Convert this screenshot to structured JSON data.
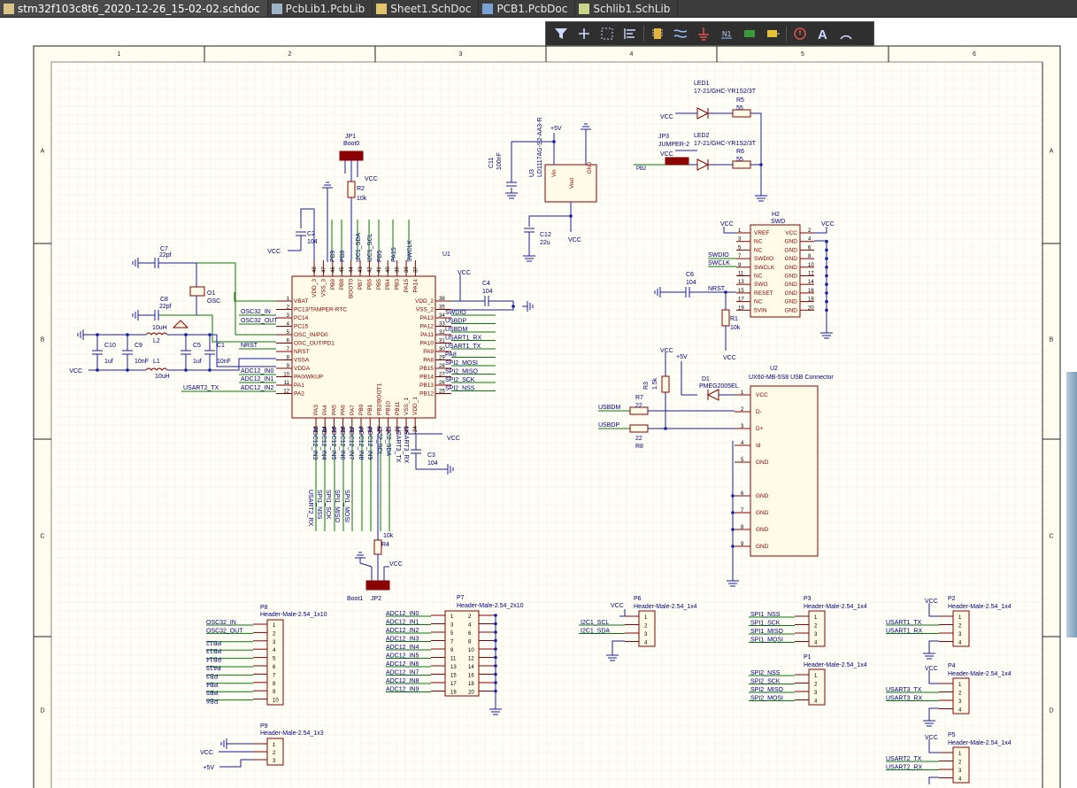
{
  "tabs": [
    {
      "label": "stm32f103c8t6_2020-12-26_15-02-02.schdoc",
      "active": true,
      "icon": "schematic-doc-icon"
    },
    {
      "label": "PcbLib1.PcbLib",
      "active": false,
      "icon": "pcblib-icon"
    },
    {
      "label": "Sheet1.SchDoc",
      "active": false,
      "icon": "schdoc-icon"
    },
    {
      "label": "PCB1.PcbDoc",
      "active": false,
      "icon": "pcbdoc-icon"
    },
    {
      "label": "Schlib1.SchLib",
      "active": false,
      "icon": "schlib-icon"
    }
  ],
  "toolbar": {
    "items": [
      "filter-icon",
      "add-icon",
      "select-rect-icon",
      "align-icon",
      "component-icon",
      "wire-icon",
      "ground-icon",
      "net-label-icon",
      "port-icon",
      "harness-icon",
      "no-erc-icon",
      "text-icon",
      "arc-icon"
    ]
  },
  "border": {
    "cols": [
      "1",
      "2",
      "3",
      "4",
      "5",
      "6"
    ],
    "rows": [
      "A",
      "B",
      "C",
      "D"
    ]
  },
  "schematic": {
    "u1": {
      "ref": "U1",
      "left_pins": [
        [
          "1",
          "VBAT"
        ],
        [
          "2",
          "PC13/TAMPER-RTC"
        ],
        [
          "3",
          "PC14"
        ],
        [
          "4",
          "PC15"
        ],
        [
          "5",
          "OSC_IN/PD0"
        ],
        [
          "6",
          "OSC_OUT/PD1"
        ],
        [
          "7",
          "NRST"
        ],
        [
          "8",
          "VSSA"
        ],
        [
          "9",
          "VDDA"
        ],
        [
          "10",
          "PA0/WKUP"
        ],
        [
          "11",
          "PA1"
        ],
        [
          "12",
          "PA2"
        ]
      ],
      "right_pins": [
        [
          "36",
          "VDD_2"
        ],
        [
          "35",
          "VSS_2"
        ],
        [
          "34",
          "PA13"
        ],
        [
          "33",
          "PA12"
        ],
        [
          "32",
          "PA11"
        ],
        [
          "31",
          "PA10"
        ],
        [
          "30",
          "PA9"
        ],
        [
          "29",
          "PA8"
        ],
        [
          "28",
          "PB15"
        ],
        [
          "27",
          "PB14"
        ],
        [
          "26",
          "PB13"
        ],
        [
          "25",
          "PB12"
        ]
      ],
      "top_pins": [
        "48",
        "47",
        "46",
        "45",
        "44",
        "43",
        "42",
        "41",
        "40",
        "39",
        "38",
        "37"
      ],
      "top_names": [
        "VDD_3",
        "VSS_3",
        "PB9",
        "PB8",
        "BOOT0",
        "PB7",
        "PB6",
        "PB5",
        "PB4",
        "PB3",
        "PA15",
        "PA14"
      ],
      "bottom_pins": [
        "13",
        "14",
        "15",
        "16",
        "17",
        "18",
        "19",
        "20",
        "21",
        "22",
        "23",
        "24"
      ],
      "bottom_names": [
        "PA3",
        "PA4",
        "PA5",
        "PA6",
        "PA7",
        "PB0",
        "PB1",
        "PB2/BOOT1",
        "PB10",
        "PB11",
        "VSS_1",
        "VDD_1"
      ]
    },
    "u1_left_nets": [
      "OSC32_IN",
      "OSC32_OUT",
      "NRST",
      "ADC12_IN0",
      "ADC12_IN1",
      "ADC12_IN2",
      "USART2_TX"
    ],
    "u1_right_nets": [
      "SWDIO",
      "USBDP",
      "USBDM",
      "USART1_RX",
      "USART1_TX",
      "PA8",
      "SPI2_MOSI",
      "SPI2_MISO",
      "SPI2_SCK",
      "SPI2_NSS"
    ],
    "u1_top_nets": [
      "PB9",
      "PB8",
      "I2C1_SDA",
      "I2C1_SCL",
      "PB5",
      "PA15",
      "SWCLK"
    ],
    "u1_bottom_nets": [
      "ADC12_IN3",
      "ADC12_IN4",
      "ADC12_IN5",
      "ADC12_IN6",
      "ADC12_IN7",
      "ADC12_IN8",
      "ADC12_IN9",
      "I2C2_SCL",
      "I2C2_SDA",
      "USART3_TX",
      "USART3_RX"
    ],
    "u1_bottom_nets2": [
      "USART2_RX",
      "SPI1_NSS",
      "SPI1_SCK",
      "SPI1_MISO",
      "SPI1_MOSI"
    ],
    "labels": {
      "jp1": "JP1",
      "jp1_val": "Boot0",
      "r2": "R2",
      "r2_val": "10k",
      "c2": "C2",
      "c2_val": "104",
      "c7": "C7",
      "c7_val": "22pf",
      "c8": "C8",
      "c8_val": "22pf",
      "o1": "O1",
      "o1_val": "OSC",
      "l2": "L2",
      "l2_val": "10uH",
      "l1": "L1",
      "l1_val": "10uH",
      "c10": "C10",
      "c10_val": "1uf",
      "c9": "C9",
      "c9_val": "10nF",
      "c5": "C5",
      "c5_val": "1uf",
      "c1": "C1",
      "c1_val": "10nF",
      "c4": "C4",
      "c4_val": "104",
      "c3": "C3",
      "c3_val": "104",
      "r4": "R4",
      "r4_val": "10k",
      "jp2": "JP2",
      "jp2_val": "Boot1",
      "u3": "U3",
      "u3_val": "LD1117AG-S2-AA3-R",
      "c11": "C11",
      "c11_val": "100nF",
      "c12": "C12",
      "c12_val": "22u",
      "vin": "Vin",
      "vout": "Vout",
      "gnd": "GND",
      "p5v": "+5V",
      "vcc": "VCC",
      "led1": "LED1",
      "led1_val": "17-21/GHC-YR1S2/3T",
      "led2": "LED2",
      "led2_val": "17-21/GHC-YR1S2/3T",
      "r5": "R5",
      "r5_val": "55",
      "r6": "R6",
      "r6_val": "55",
      "jp3": "JP3",
      "jp3_val": "JUMPER-2",
      "pb2": "PB2",
      "h2": "H2",
      "h2_val": "SWD",
      "c6": "C6",
      "c6_val": "104",
      "r1": "R1",
      "r1_val": "10k",
      "swdio": "SWDIO",
      "swclk": "SWCLK",
      "nrst": "NRST",
      "d1": "D1",
      "d1_val": "PMEG2005EL",
      "r3": "R3",
      "r3_val": "1.5k",
      "r7": "R7",
      "r7_val": "22",
      "r8": "R8",
      "r8_val": "22",
      "u2": "U2",
      "u2_val": "UX60-MB-5S8 USB Connector",
      "usbdm": "USBDM",
      "usbdp": "USBDP"
    },
    "h2_left": [
      [
        "1",
        "VREF"
      ],
      [
        "3",
        "NC"
      ],
      [
        "5",
        "NC"
      ],
      [
        "7",
        "SWDIO"
      ],
      [
        "9",
        "SWCLK"
      ],
      [
        "11",
        "NC"
      ],
      [
        "13",
        "SWO"
      ],
      [
        "15",
        "RESET"
      ],
      [
        "17",
        "NC"
      ],
      [
        "19",
        "5VIN"
      ]
    ],
    "h2_right": [
      [
        "2",
        "VCC"
      ],
      [
        "4",
        "GND"
      ],
      [
        "6",
        "GND"
      ],
      [
        "8",
        "GND"
      ],
      [
        "10",
        "GND"
      ],
      [
        "12",
        "GND"
      ],
      [
        "14",
        "GND"
      ],
      [
        "16",
        "GND"
      ],
      [
        "18",
        "GND"
      ],
      [
        "20",
        "GND"
      ]
    ],
    "u2_pins": [
      [
        "1",
        "VCC"
      ],
      [
        "2",
        "D-"
      ],
      [
        "3",
        "D+"
      ],
      [
        "4",
        "Id"
      ],
      [
        "5",
        "GND"
      ],
      [
        "6",
        "GND"
      ],
      [
        "7",
        "GND"
      ],
      [
        "8",
        "GND"
      ],
      [
        "9",
        "GND"
      ]
    ],
    "p8": {
      "ref": "P8",
      "val": "Header-Male-2.54_1x10",
      "nets": [
        "OSC32_IN",
        "OSC32_OUT",
        "PB12",
        "PB13",
        "PB14",
        "PA15",
        "PB3",
        "PB4",
        "PB5",
        "PB6"
      ]
    },
    "p9": {
      "ref": "P9",
      "val": "Header-Male-2.54_1x3"
    },
    "p7": {
      "ref": "P7",
      "val": "Header-Male-2.54_2x10",
      "nets": [
        "ADC12_IN0",
        "ADC12_IN1",
        "ADC12_IN2",
        "ADC12_IN3",
        "ADC12_IN4",
        "ADC12_IN5",
        "ADC12_IN6",
        "ADC12_IN7",
        "ADC12_IN8",
        "ADC12_IN9"
      ],
      "left": [
        "1",
        "3",
        "5",
        "7",
        "9",
        "11",
        "13",
        "15",
        "17",
        "19"
      ],
      "right": [
        "2",
        "4",
        "6",
        "8",
        "10",
        "12",
        "14",
        "16",
        "18",
        "20"
      ]
    },
    "p6": {
      "ref": "P6",
      "val": "Header-Male-2.54_1x4",
      "nets": [
        "I2C1_SCL",
        "I2C1_SDA"
      ]
    },
    "p3": {
      "ref": "P3",
      "val": "Header-Male-2.54_1x4",
      "nets": [
        "SPI1_NSS",
        "SPI1_SCK",
        "SPI1_MISO",
        "SPI1_MOSI"
      ]
    },
    "p1": {
      "ref": "P1",
      "val": "Header-Male-2.54_1x4",
      "nets": [
        "SPI2_NSS",
        "SPI2_SCK",
        "SPI2_MISO",
        "SPI2_MOSI"
      ]
    },
    "p2": {
      "ref": "P2",
      "val": "Header-Male-2.54_1x4",
      "nets": [
        "USART1_TX",
        "USART1_RX"
      ]
    },
    "p4": {
      "ref": "P4",
      "val": "Header-Male-2.54_1x4",
      "nets": [
        "USART3_TX",
        "USART3_RX"
      ]
    },
    "p5": {
      "ref": "P5",
      "val": "Header-Male-2.54_1x4",
      "nets": [
        "USART2_TX",
        "USART2_RX"
      ]
    }
  }
}
